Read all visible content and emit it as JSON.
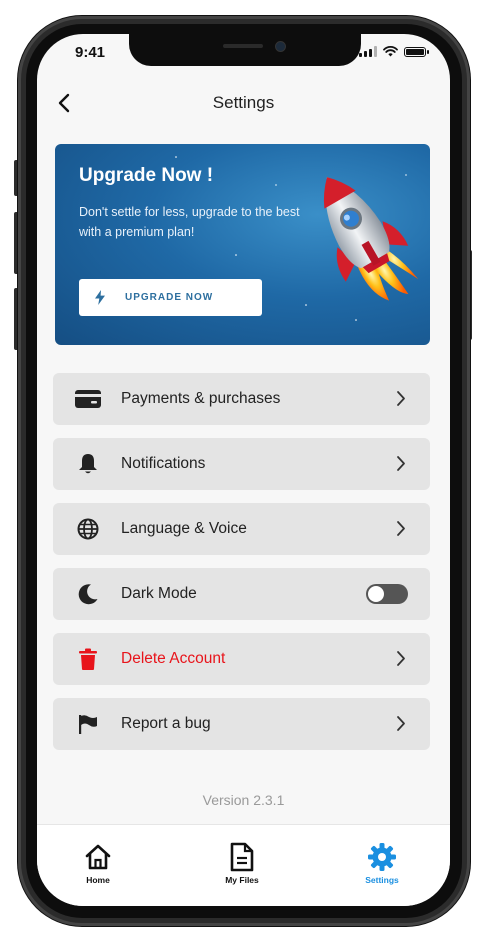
{
  "status_bar": {
    "time": "9:41"
  },
  "header": {
    "title": "Settings"
  },
  "banner": {
    "title": "Upgrade Now !",
    "subtitle": "Don't settle for less, upgrade to the best with a premium plan!",
    "button_label": "UPGRADE NOW"
  },
  "menu": {
    "payments": "Payments & purchases",
    "notifications": "Notifications",
    "language": "Language & Voice",
    "dark_mode": "Dark Mode",
    "delete_account": "Delete Account",
    "report_bug": "Report a bug"
  },
  "dark_mode_enabled": false,
  "version": "Version 2.3.1",
  "bottom_nav": {
    "home": "Home",
    "files": "My Files",
    "settings": "Settings",
    "active": "settings"
  },
  "colors": {
    "accent": "#1a8fe0",
    "danger": "#e8141b",
    "banner": "#1f69a6"
  },
  "icons": {
    "payments": "credit-card-icon",
    "notifications": "bell-icon",
    "language": "globe-icon",
    "dark_mode": "moon-icon",
    "delete_account": "trash-icon",
    "report_bug": "flag-icon"
  }
}
